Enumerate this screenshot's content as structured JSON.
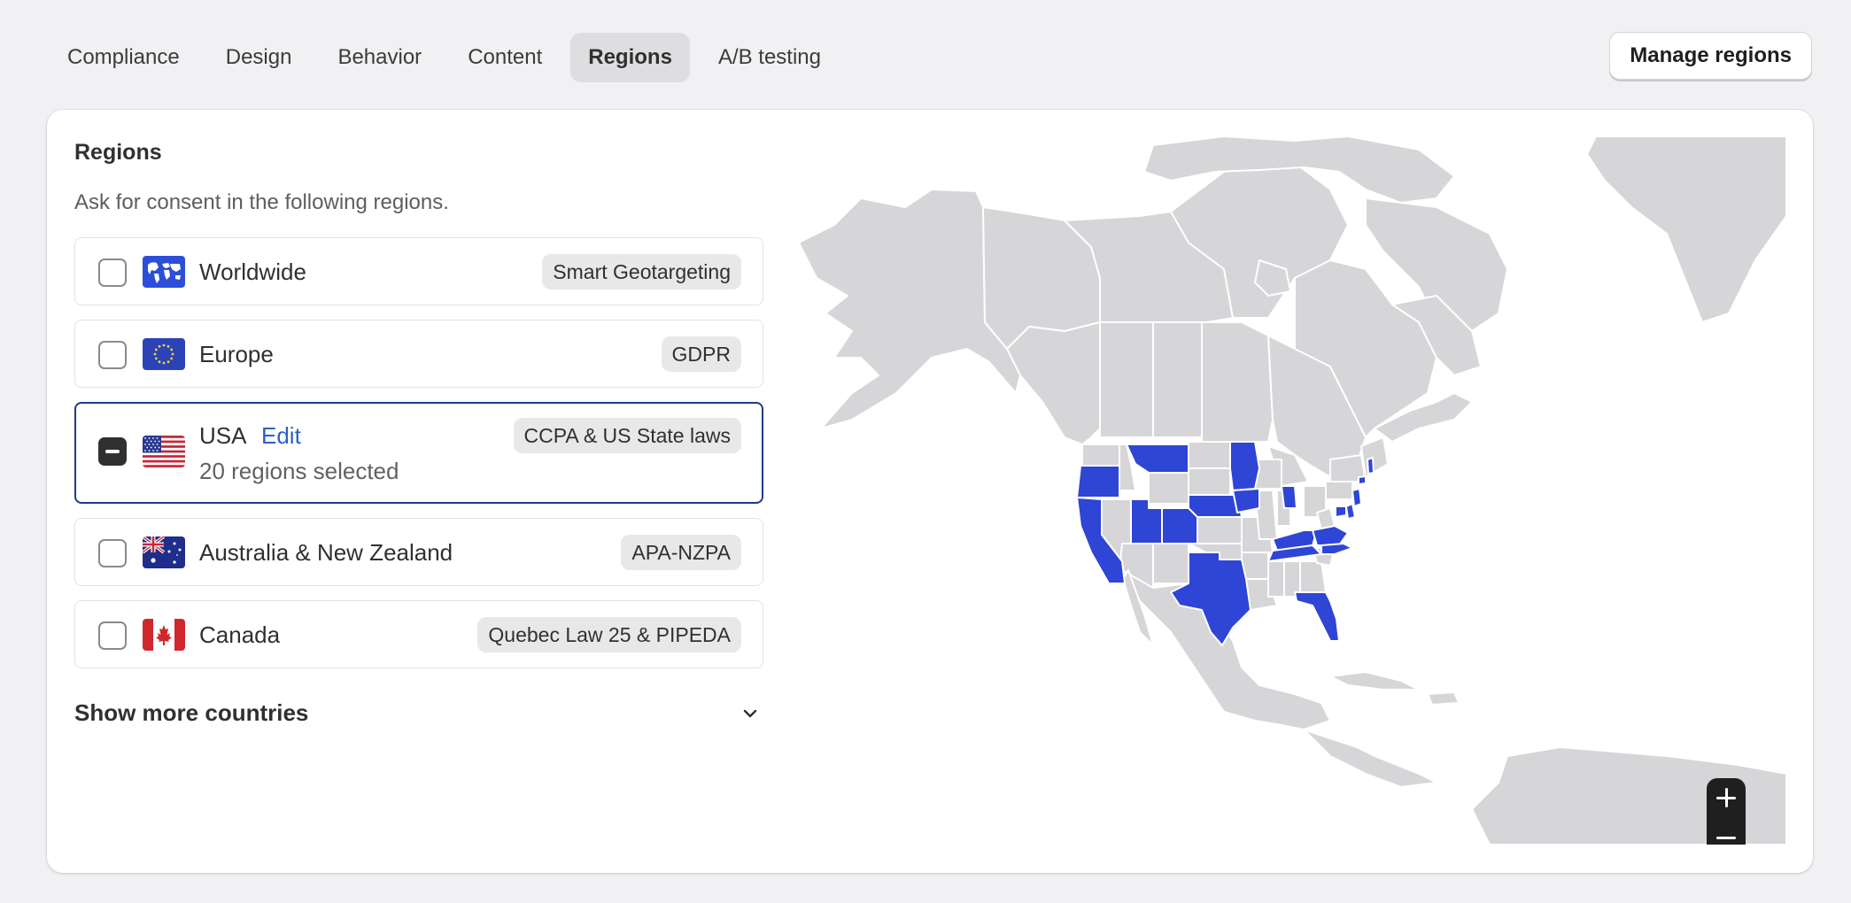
{
  "tabs": [
    {
      "label": "Compliance"
    },
    {
      "label": "Design"
    },
    {
      "label": "Behavior"
    },
    {
      "label": "Content"
    },
    {
      "label": "Regions",
      "active": true
    },
    {
      "label": "A/B testing"
    }
  ],
  "header": {
    "manage_label": "Manage regions"
  },
  "section": {
    "title": "Regions",
    "subtitle": "Ask for consent in the following regions."
  },
  "regions": [
    {
      "name": "Worldwide",
      "badge": "Smart Geotargeting",
      "flag": "world-flag-icon",
      "checked": "unchecked"
    },
    {
      "name": "Europe",
      "badge": "GDPR",
      "flag": "eu-flag-icon",
      "checked": "unchecked"
    },
    {
      "name": "USA",
      "edit_label": "Edit",
      "sub": "20 regions selected",
      "badge": "CCPA & US State laws",
      "flag": "us-flag-icon",
      "checked": "indeterminate"
    },
    {
      "name": "Australia & New Zealand",
      "badge": "APA-NZPA",
      "flag": "australia-flag-icon",
      "checked": "unchecked"
    },
    {
      "name": "Canada",
      "badge": "Quebec Law 25 & PIPEDA",
      "flag": "canada-flag-icon",
      "checked": "unchecked"
    }
  ],
  "show_more_label": "Show more countries",
  "map": {
    "land_color": "#d6d6d9",
    "selected_color": "#2e45d6",
    "border_color": "#ffffff"
  },
  "colors": {
    "accent": "#1d3a8a",
    "link": "#2c5fc7",
    "page_bg": "#f1f1f3"
  }
}
